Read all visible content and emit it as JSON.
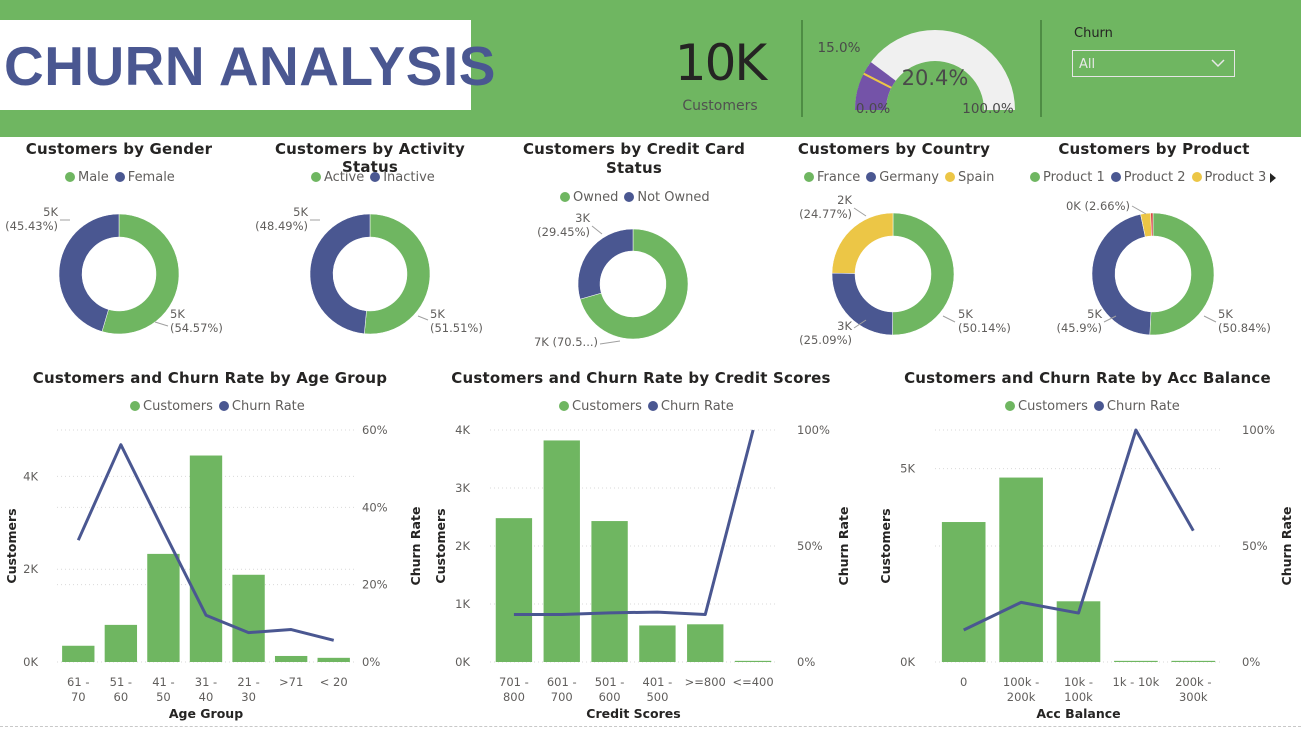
{
  "header": {
    "title": "CHURN ANALYSIS",
    "kpi": {
      "value": "10K",
      "label": "Customers"
    },
    "gauge": {
      "value_label": "20.4%",
      "value": 0.204,
      "target_label": "15.0%",
      "target": 0.15,
      "min_label": "0.0%",
      "max_label": "100.0%"
    },
    "slicer": {
      "title": "Churn",
      "value": "All"
    }
  },
  "colors": {
    "green": "#6fb661",
    "navy": "#4a5791",
    "yellow": "#ecc646",
    "red": "#d64545",
    "gauge_fill": "#7453a8",
    "gauge_bg": "#f0f0f0",
    "white": "#ffffff"
  },
  "chart_data": [
    {
      "id": "gender",
      "type": "donut",
      "title": "Customers by Gender",
      "legend": [
        "Male",
        "Female"
      ],
      "values": [
        54.57,
        45.43
      ],
      "labels": [
        [
          "5K",
          "(54.57%)"
        ],
        [
          "5K",
          "(45.43%)"
        ]
      ]
    },
    {
      "id": "activity",
      "type": "donut",
      "title": "Customers by Activity Status",
      "legend": [
        "Active",
        "Inactive"
      ],
      "values": [
        51.51,
        48.49
      ],
      "labels": [
        [
          "5K",
          "(51.51%)"
        ],
        [
          "5K",
          "(48.49%)"
        ]
      ]
    },
    {
      "id": "credit_card",
      "type": "donut",
      "title_line1": "Customers by Credit Card",
      "title_line2": "Status",
      "legend": [
        "Owned",
        "Not Owned"
      ],
      "values": [
        70.55,
        29.45
      ],
      "labels": [
        [
          "7K (70.5...)"
        ],
        [
          "3K",
          "(29.45%)"
        ]
      ]
    },
    {
      "id": "country",
      "type": "donut",
      "title": "Customers by Country",
      "legend": [
        "France",
        "Germany",
        "Spain"
      ],
      "values": [
        50.14,
        25.09,
        24.77
      ],
      "labels": [
        [
          "5K",
          "(50.14%)"
        ],
        [
          "3K",
          "(25.09%)"
        ],
        [
          "2K",
          "(24.77%)"
        ]
      ]
    },
    {
      "id": "product",
      "type": "donut",
      "title": "Customers by Product",
      "legend": [
        "Product 1",
        "Product 2",
        "Product 3"
      ],
      "values": [
        50.84,
        45.9,
        2.66,
        0.6
      ],
      "labels": [
        [
          "5K",
          "(50.84%)"
        ],
        [
          "5K",
          "(45.9%)"
        ],
        [
          "0K (2.66%)"
        ]
      ]
    },
    {
      "id": "age",
      "type": "bar+line",
      "title": "Customers and Churn Rate by Age Group",
      "legend": [
        "Customers",
        "Churn Rate"
      ],
      "categories": [
        [
          "61 -",
          "70"
        ],
        [
          "51 -",
          "60"
        ],
        [
          "41 -",
          "50"
        ],
        [
          "31 -",
          "40"
        ],
        [
          "21 -",
          "30"
        ],
        [
          ">71"
        ],
        [
          "< 20"
        ]
      ],
      "bars": [
        350,
        800,
        2330,
        4450,
        1880,
        130,
        90
      ],
      "line": [
        31.5,
        56.2,
        34.0,
        12.1,
        7.6,
        8.4,
        5.6
      ],
      "xlabel": "Age Group",
      "ylabel": "Customers",
      "y2label": "Churn Rate",
      "ylim": [
        0,
        5000
      ],
      "y2lim": [
        0,
        60
      ],
      "yticks": [
        [
          0,
          "0K"
        ],
        [
          2000,
          "2K"
        ],
        [
          4000,
          "4K"
        ]
      ],
      "y2ticks": [
        [
          0,
          "0%"
        ],
        [
          20,
          "20%"
        ],
        [
          40,
          "40%"
        ],
        [
          60,
          "60%"
        ]
      ]
    },
    {
      "id": "credit_score",
      "type": "bar+line",
      "title": "Customers and Churn Rate by Credit Scores",
      "legend": [
        "Customers",
        "Churn Rate"
      ],
      "categories": [
        [
          "701 -",
          "800"
        ],
        [
          "601 -",
          "700"
        ],
        [
          "501 -",
          "600"
        ],
        [
          "401 -",
          "500"
        ],
        [
          ">=800"
        ],
        [
          "<=400"
        ]
      ],
      "bars": [
        2480,
        3820,
        2430,
        630,
        650,
        20
      ],
      "line": [
        20.5,
        20.5,
        21.2,
        21.5,
        20.5,
        100
      ],
      "xlabel": "Credit Scores",
      "ylabel": "Customers",
      "y2label": "Churn Rate",
      "ylim": [
        0,
        4000
      ],
      "y2lim": [
        0,
        100
      ],
      "yticks": [
        [
          0,
          "0K"
        ],
        [
          1000,
          "1K"
        ],
        [
          2000,
          "2K"
        ],
        [
          3000,
          "3K"
        ],
        [
          4000,
          "4K"
        ]
      ],
      "y2ticks": [
        [
          0,
          "0%"
        ],
        [
          50,
          "50%"
        ],
        [
          100,
          "100%"
        ]
      ]
    },
    {
      "id": "balance",
      "type": "bar+line",
      "title": "Customers and Churn Rate by Acc Balance",
      "legend": [
        "Customers",
        "Churn Rate"
      ],
      "categories": [
        [
          "0"
        ],
        [
          "100k -",
          "200k"
        ],
        [
          "10k -",
          "100k"
        ],
        [
          "1k - 10k"
        ],
        [
          "200k -",
          "300k"
        ]
      ],
      "bars": [
        3620,
        4770,
        1570,
        30,
        30
      ],
      "line": [
        13.8,
        25.7,
        21.1,
        100,
        56.6
      ],
      "xlabel": "Acc Balance",
      "ylabel": "Customers",
      "y2label": "Churn Rate",
      "ylim": [
        0,
        6000
      ],
      "y2lim": [
        0,
        100
      ],
      "yticks": [
        [
          0,
          "0K"
        ],
        [
          5000,
          "5K"
        ]
      ],
      "y2ticks": [
        [
          0,
          "0%"
        ],
        [
          50,
          "50%"
        ],
        [
          100,
          "100%"
        ]
      ]
    }
  ]
}
